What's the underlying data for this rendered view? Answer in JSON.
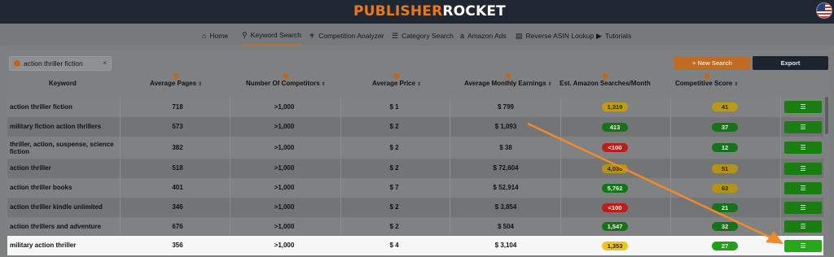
{
  "app": {
    "logo_part1": "PUBLISHER",
    "logo_part2": "ROCKET",
    "brand_color": "#e8791c",
    "flag_icon": "us-flag-icon"
  },
  "nav": [
    {
      "label": "Home",
      "icon": "home-icon",
      "glyph": "⌂"
    },
    {
      "label": "Keyword Search",
      "icon": "search-icon",
      "glyph": "⚲",
      "active": true
    },
    {
      "label": "Competition Analyzer",
      "icon": "ribbon-icon",
      "glyph": "⚜"
    },
    {
      "label": "Category Search",
      "icon": "list-icon",
      "glyph": "☰"
    },
    {
      "label": "Amazon Ads",
      "icon": "amazon-icon",
      "glyph": "a"
    },
    {
      "label": "Reverse ASIN Lookup",
      "icon": "book-icon",
      "glyph": "▤"
    },
    {
      "label": "Tutorials",
      "icon": "play-icon",
      "glyph": "▶"
    }
  ],
  "search_tab": {
    "label": "action thriller fiction",
    "close": "×"
  },
  "buttons": {
    "new_search": "+ New Search",
    "export": "Export"
  },
  "table": {
    "headers": [
      "Keyword",
      "Average Pages",
      "Number Of Competitors",
      "Average Price",
      "Average Monthly Earnings",
      "Est. Amazon Searches/Month",
      "Competitive Score"
    ],
    "rows": [
      {
        "keyword": "action thriller fiction",
        "pages": "718",
        "competitors": ">1,000",
        "price": "$ 1",
        "earnings": "$ 799",
        "searches": "1,319",
        "searches_color": "#c29a1a",
        "score": "41",
        "score_color": "#b9991a"
      },
      {
        "keyword": "military fiction action thrillers",
        "pages": "573",
        "competitors": ">1,000",
        "price": "$ 2",
        "earnings": "$ 1,093",
        "searches": "413",
        "searches_color": "#17731a",
        "score": "37",
        "score_color": "#17731a"
      },
      {
        "keyword": "thriller, action, suspense, science fiction",
        "pages": "382",
        "competitors": ">1,000",
        "price": "$ 2",
        "earnings": "$ 38",
        "searches": "<100",
        "searches_color": "#b8211a",
        "score": "12",
        "score_color": "#17731a"
      },
      {
        "keyword": "action thriller",
        "pages": "518",
        "competitors": ">1,000",
        "price": "$ 2",
        "earnings": "$ 72,604",
        "searches": "4,038",
        "searches_color": "#b3921a",
        "score": "51",
        "score_color": "#b3921a"
      },
      {
        "keyword": "action thriller books",
        "pages": "401",
        "competitors": ">1,000",
        "price": "$ 7",
        "earnings": "$ 52,914",
        "searches": "5,762",
        "searches_color": "#17731a",
        "score": "63",
        "score_color": "#b3921a"
      },
      {
        "keyword": "action thriller kindle unlimited",
        "pages": "346",
        "competitors": ">1,000",
        "price": "$ 2",
        "earnings": "$ 3,854",
        "searches": "<100",
        "searches_color": "#b8211a",
        "score": "21",
        "score_color": "#17731a"
      },
      {
        "keyword": "action thrillers and adventure",
        "pages": "676",
        "competitors": ">1,000",
        "price": "$ 2",
        "earnings": "$ 504",
        "searches": "1,547",
        "searches_color": "#17731a",
        "score": "32",
        "score_color": "#17731a"
      },
      {
        "keyword": "military action thriller",
        "pages": "356",
        "competitors": ">1,000",
        "price": "$ 4",
        "earnings": "$ 3,104",
        "searches": "1,353",
        "searches_color": "#f0c419",
        "score": "27",
        "score_color": "#23a01a"
      }
    ],
    "action_icon": "list-icon",
    "action_glyph": "☰"
  },
  "annotation": {
    "arrow_color": "#f08a2c",
    "arrow_icon": "annotation-arrow"
  }
}
